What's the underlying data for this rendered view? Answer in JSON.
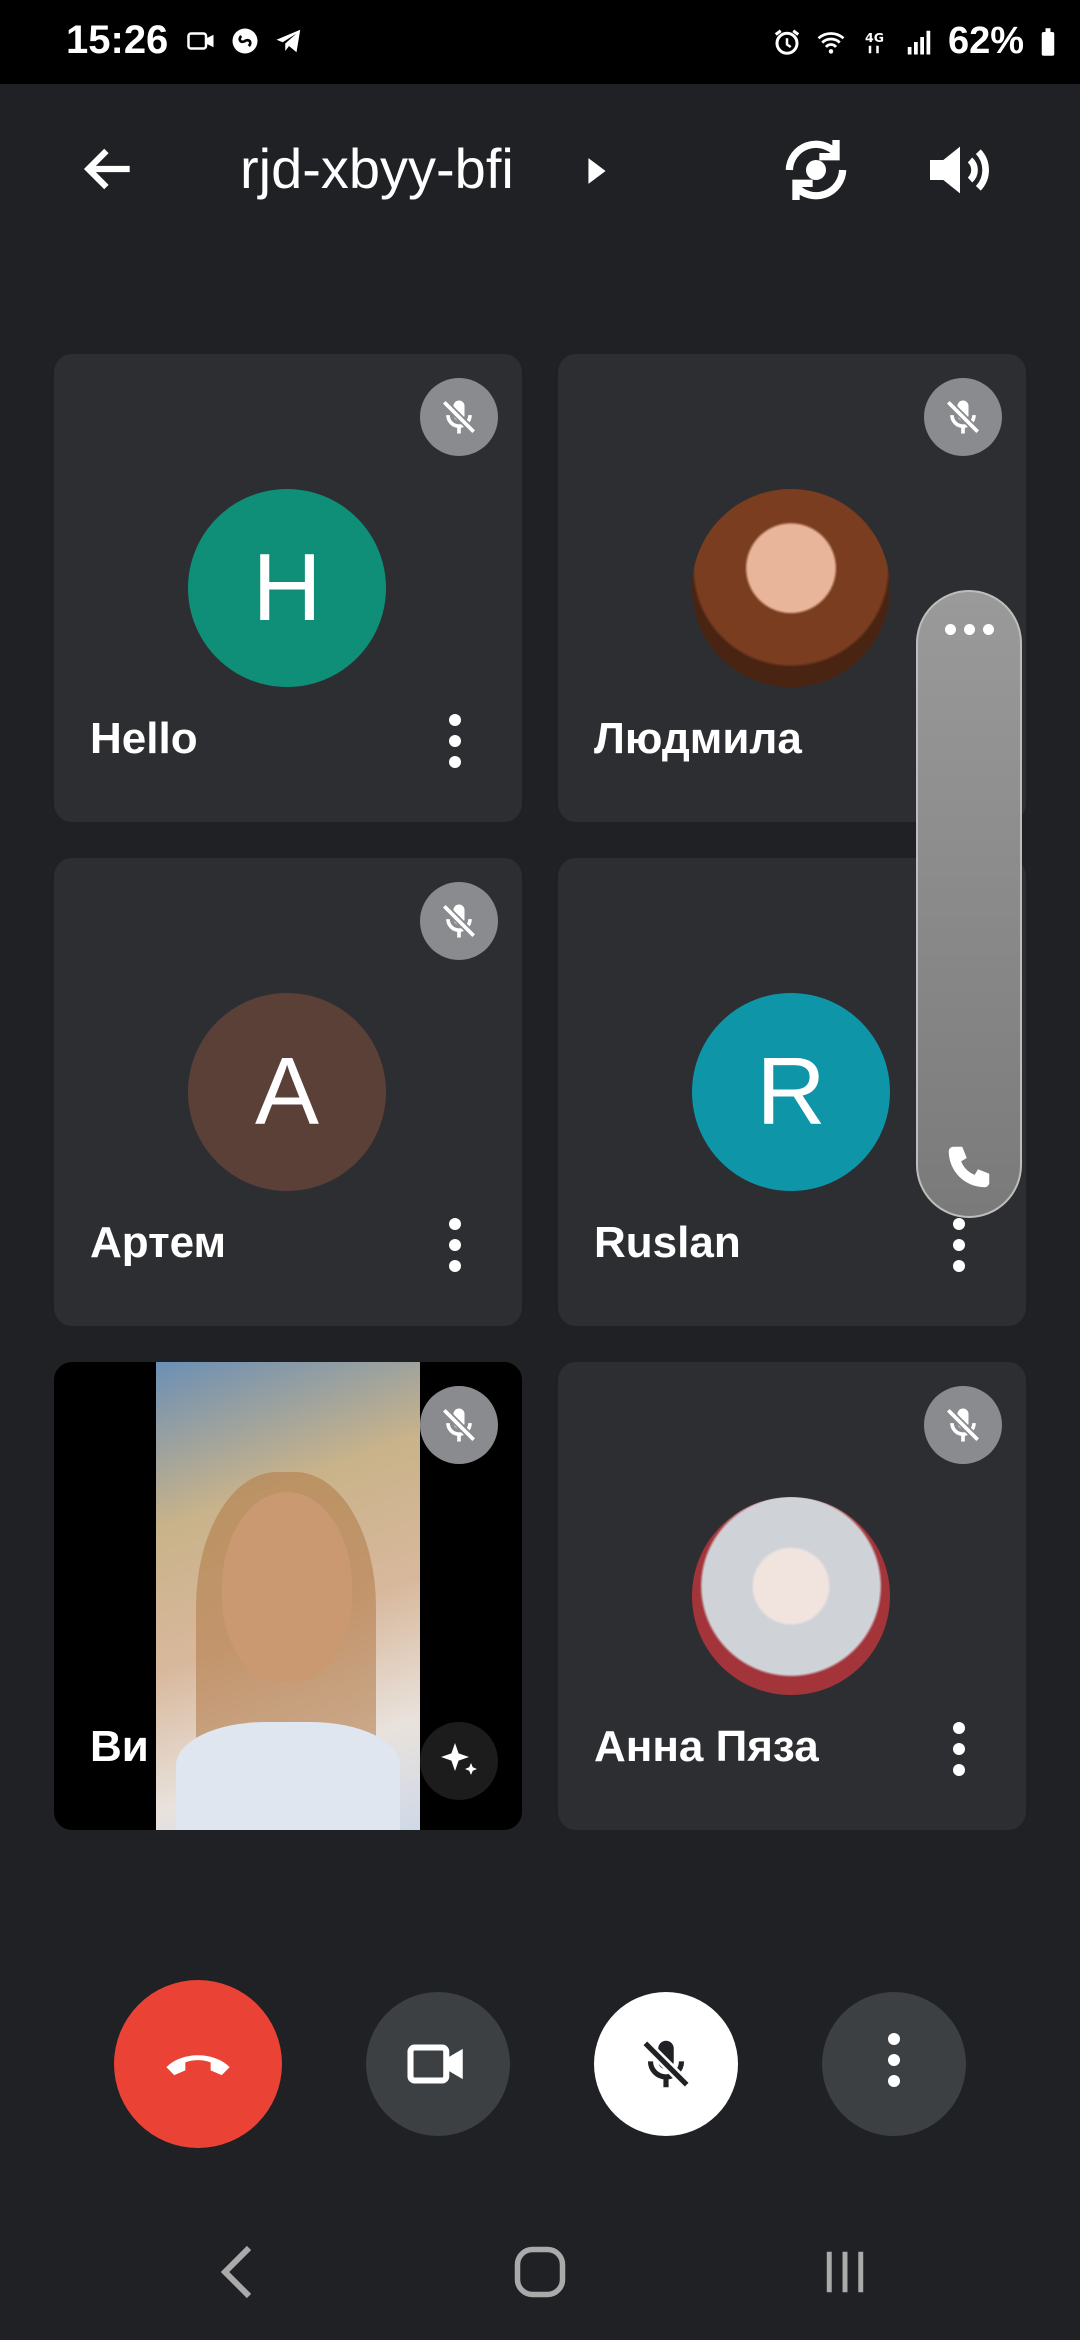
{
  "status_bar": {
    "time": "15:26",
    "battery": "62%"
  },
  "header": {
    "meeting_code": "rjd-xbyy-bfi"
  },
  "participants": [
    {
      "name": "Hello",
      "initial": "H",
      "avatar_color": "#0f8f78"
    },
    {
      "name": "Людмила",
      "initial": "",
      "avatar_color": "#6a3b22"
    },
    {
      "name": "Артем",
      "initial": "A",
      "avatar_color": "#5b4038"
    },
    {
      "name": "Ruslan",
      "initial": "R",
      "avatar_color": "#0e95a8"
    },
    {
      "name": "Ви",
      "initial": "",
      "avatar_color": "#000000"
    },
    {
      "name": "Анна Пяза",
      "initial": "",
      "avatar_color": "#c9cdd2"
    }
  ],
  "colors": {
    "end_call": "#ea4335",
    "control_bg": "#3c4043",
    "mic_active_bg": "#ffffff"
  }
}
